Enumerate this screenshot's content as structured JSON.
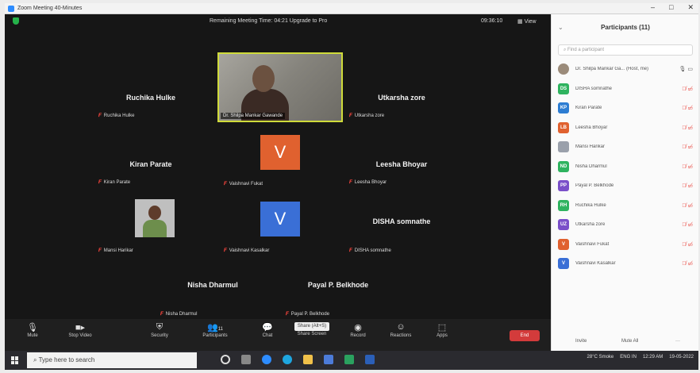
{
  "window": {
    "title": "Zoom Meeting 40-Minutes",
    "controls": [
      "–",
      "□",
      "✕"
    ]
  },
  "meeting": {
    "info": "Remaining Meeting Time: 04:21 Upgrade to Pro",
    "timer": "09:36:10",
    "view_label": "View"
  },
  "tiles": {
    "ruchika": {
      "big": "Ruchika Hulke",
      "small": "Ruchika Hulke"
    },
    "utkarsha": {
      "big": "Utkarsha zore",
      "small": "Utkarsha zore"
    },
    "kiran": {
      "big": "Kiran Parate",
      "small": "Kiran Parate"
    },
    "vaishnavi_f": {
      "letter": "V",
      "small": "Vaishnavi Fukat"
    },
    "leesha": {
      "big": "Leesha Bhoyar",
      "small": "Leesha Bhoyar"
    },
    "mansi": {
      "small": "Mansi Harikar"
    },
    "vaishnavi_k": {
      "letter": "V",
      "small": "Vaishnavi Kasalkar"
    },
    "disha": {
      "big": "DISHA somnathe",
      "small": "DISHA somnathe"
    },
    "nisha": {
      "big": "Nisha Dharmul",
      "small": "Nisha Dharmul"
    },
    "payal": {
      "big": "Payal P. Belkhode",
      "small": "Payal P. Belkhode"
    },
    "host_video": {
      "caption": "Dr. Shilpa Mankar Gawande"
    }
  },
  "toolbar": {
    "mute": "Mute",
    "stop_video": "Stop Video",
    "security": "Security",
    "participants": "Participants",
    "participants_count": "11",
    "chat": "Chat",
    "share": "Share Screen",
    "share_pill": "Share (Alt+S)",
    "record": "Record",
    "reactions": "Reactions",
    "apps": "Apps",
    "end": "End"
  },
  "participants_panel": {
    "title": "Participants (11)",
    "search_placeholder": "Find a participant",
    "items": [
      {
        "initials": "",
        "name": "Dr. Shilpa Mankar Ga... (Host, me)",
        "color": "#9b8b7a"
      },
      {
        "initials": "DS",
        "name": "DISHA somnathe",
        "color": "#2fb35f"
      },
      {
        "initials": "KP",
        "name": "Kiran Parate",
        "color": "#2d7dd2"
      },
      {
        "initials": "LB",
        "name": "Leesha Bhoyar",
        "color": "#e0612f"
      },
      {
        "initials": "",
        "name": "Mansi Harikar",
        "color": "#9aa0ab"
      },
      {
        "initials": "ND",
        "name": "Nisha Dharmul",
        "color": "#2fb35f"
      },
      {
        "initials": "PP",
        "name": "Payal P. Belkhode",
        "color": "#7a4fc9"
      },
      {
        "initials": "RH",
        "name": "Ruchika Hulke",
        "color": "#2fb35f"
      },
      {
        "initials": "UZ",
        "name": "Utkarsha zore",
        "color": "#7a4fc9"
      },
      {
        "initials": "V",
        "name": "Vaishnavi Fukat",
        "color": "#e0612f"
      },
      {
        "initials": "V",
        "name": "Vaishnavi Kasalkar",
        "color": "#3a6fd6"
      }
    ],
    "invite": "Invite",
    "mute_all": "Mute All"
  },
  "taskbar": {
    "search_placeholder": "Type here to search",
    "weather": "28°C Smoke",
    "lang": "ENG IN",
    "time": "12:29 AM",
    "date": "19-05-2022"
  },
  "colors": {
    "vaishnavi_f": "#e0612f",
    "vaishnavi_k": "#3a6fd6",
    "active_border": "#cfdb3a",
    "end": "#d33b3b"
  }
}
